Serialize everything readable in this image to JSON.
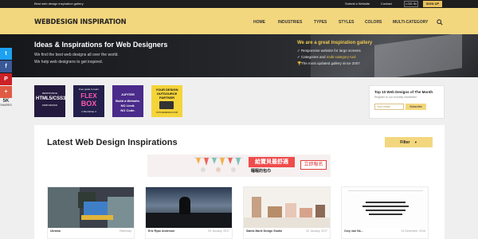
{
  "topbar": {
    "tagline": "Best web design inspiration gallery",
    "submit": "Submit a Website",
    "contact": "Contact",
    "login": "LOG IN",
    "signup": "SIGN UP"
  },
  "nav": {
    "logo": "WEBDESIGN INSPIRATION",
    "items": [
      "HOME",
      "INDUSTRIES",
      "TYPES",
      "STYLES",
      "COLORS",
      "MULTI-CATEGORY"
    ],
    "search_icon": "search-icon"
  },
  "hero": {
    "title": "Ideas & Inspirations for Web Designers",
    "line1": "We find the best web designs all over the world.",
    "line2": "We help web designers to get inspired.",
    "great": "We are a great inspiration gallery",
    "bullets": [
      {
        "icon": "check-icon",
        "text": "Responsive website for large screens",
        "link": ""
      },
      {
        "icon": "check-icon",
        "text": "Categories and ",
        "link": "multi-category tool"
      },
      {
        "icon": "trophy-icon",
        "text": "The most updated gallery since 2007",
        "link": ""
      }
    ]
  },
  "social": {
    "buttons": [
      {
        "name": "twitter",
        "glyph": "t",
        "color": "#1da1f2"
      },
      {
        "name": "facebook",
        "glyph": "f",
        "color": "#3b5998"
      },
      {
        "name": "pinterest",
        "glyph": "P",
        "color": "#cb2027"
      },
      {
        "name": "google-plus",
        "glyph": "+",
        "color": "#e05b44"
      }
    ],
    "count": "5K",
    "share_label": "SHARES"
  },
  "ads": [
    {
      "text": [
        "RESPONSIVE",
        "HTML5/CSS3",
        "WEB DESIGN"
      ],
      "color": "#241a3d"
    },
    {
      "text": [
        "Free guide to learn",
        "FLEX",
        "BOX",
        "in Bootstrap 4"
      ],
      "color": "#23204b"
    },
    {
      "text": [
        "JUPITER",
        "Build a Website.",
        "NO Limit.",
        "NO Code."
      ],
      "color": "#4a2a8a"
    },
    {
      "text": [
        "YOUR DESIGN",
        "OUTSOURCE",
        "PARTNER",
        "OUTLINEDESIGN.COM"
      ],
      "color": "#f5d43a"
    }
  ],
  "newsletter": {
    "title": "Top 10 Web Designs of The Month",
    "register": "Register to our monthly newsletter",
    "placeholder": "Your email",
    "button": "Subscribe"
  },
  "latest": {
    "title": "Latest Web Design Inspirations",
    "filter": "Filter",
    "banner": {
      "headline": "給寶貝最舒適",
      "sub": "睡眠的包巾",
      "button": "立即報名"
    },
    "thumbs": [
      {
        "title": "Ukraina",
        "date": "Yesterday"
      },
      {
        "title": "Eric Ryan Anderson",
        "date": "03 January, 2017"
      },
      {
        "title": "Saints Marie Design Studio",
        "date": "02 January, 2017"
      },
      {
        "title": "Cory van Ga...",
        "date": "31 December, 2016"
      }
    ]
  },
  "colors": {
    "accent": "#f3d77e",
    "dark": "#1e1e1e",
    "gold_text": "#f1c94f"
  }
}
